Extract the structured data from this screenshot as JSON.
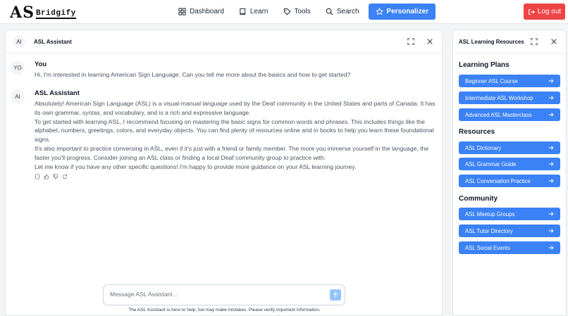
{
  "brand": {
    "logo_main": "AS",
    "logo_sub": "Bridgify"
  },
  "nav": {
    "items": [
      {
        "label": "Dashboard",
        "icon": "grid-icon"
      },
      {
        "label": "Learn",
        "icon": "book-icon"
      },
      {
        "label": "Tools",
        "icon": "tag-icon"
      },
      {
        "label": "Search",
        "icon": "search-icon"
      },
      {
        "label": "Personalizer",
        "icon": "star-icon",
        "active": true
      }
    ],
    "logout_label": "Log out"
  },
  "colors": {
    "primary": "#3b82f6",
    "danger": "#ef4444",
    "send_disabled": "#93c5fd"
  },
  "chat": {
    "header_avatar": "AI",
    "header_title": "ASL Assistant",
    "messages": [
      {
        "avatar": "YO",
        "name": "You",
        "paragraphs": [
          "Hi, I'm interested in learning American Sign Language. Can you tell me more about the basics and how to get started?"
        ]
      },
      {
        "avatar": "AI",
        "name": "ASL Assistant",
        "paragraphs": [
          "Absolutely! American Sign Language (ASL) is a visual-manual language used by the Deaf community in the United States and parts of Canada. It has its own grammar, syntax, and vocabulary, and is a rich and expressive language.",
          "To get started with learning ASL, I recommend focusing on mastering the basic signs for common words and phrases. This includes things like the alphabet, numbers, greetings, colors, and everyday objects. You can find plenty of resources online and in books to help you learn these foundational signs.",
          "It's also important to practice conversing in ASL, even if it's just with a friend or family member. The more you immerse yourself in the language, the faster you'll progress. Consider joining an ASL class or finding a local Deaf community group to practice with.",
          "Let me know if you have any other specific questions! I'm happy to provide more guidance on your ASL learning journey."
        ]
      }
    ],
    "input_placeholder": "Message ASL Assistant...",
    "disclaimer": "The ASL Assistant is here to help, but may make mistakes. Please verify important information."
  },
  "resources_panel": {
    "title": "ASL Learning Resources",
    "sections": [
      {
        "heading": "Learning Plans",
        "items": [
          "Beginner ASL Course",
          "Intermediate ASL Workshop",
          "Advanced ASL Masterclass"
        ]
      },
      {
        "heading": "Resources",
        "items": [
          "ASL Dictionary",
          "ASL Grammar Guide",
          "ASL Conversation Practice"
        ]
      },
      {
        "heading": "Community",
        "items": [
          "ASL Meetup Groups",
          "ASL Tutor Directory",
          "ASL Social Events"
        ]
      }
    ]
  }
}
